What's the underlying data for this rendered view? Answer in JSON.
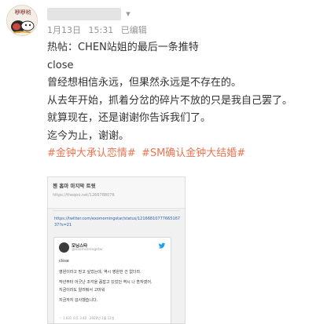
{
  "header": {
    "avatar_icon": "cartoon-avatar-icon",
    "avatar_text": "咿咿哟",
    "chevron_icon": "chevron-down-icon",
    "date": "1月13日",
    "time": "15:31",
    "edited": "已编辑"
  },
  "post": {
    "lines": [
      "热帖：CHEN站姐的最后一条推特",
      "close",
      "曾经想相信永远，但果然永远是不存在的。",
      "从去年开始，抓着分岔的碎片不放的只是我自己罢了。",
      "就算现在，还是谢谢你告诉我们了。",
      "迄今为止，谢谢。"
    ],
    "tags": [
      "#金钟大承认恋情#",
      "#SM确认金钟大结婚#"
    ],
    "tag_color": "#eb7350"
  },
  "image": {
    "title": "첸 홈마 마지막 트윗",
    "url1": "https://theqoo.net/1266788076",
    "link": "https://twitter.com/exomorningstar/status/1216681077766516737?s=21",
    "tweet": {
      "name": "모닝스타",
      "handle": "@exomorningstar",
      "lines": [
        "close",
        "",
        "영원이라고 믿고 싶었는데, 역시 영원한 건 없더라.",
        "",
        "작년부터 어긋난 조각을 꼼잡고 있었던 역시 나 혼자였어.",
        "지금이라도 알려줘서 고마워",
        "",
        "지금까지 감사했습니다."
      ],
      "footer": "♡ 1,631  오후 3:40 · 2020년 1월 12일"
    }
  }
}
